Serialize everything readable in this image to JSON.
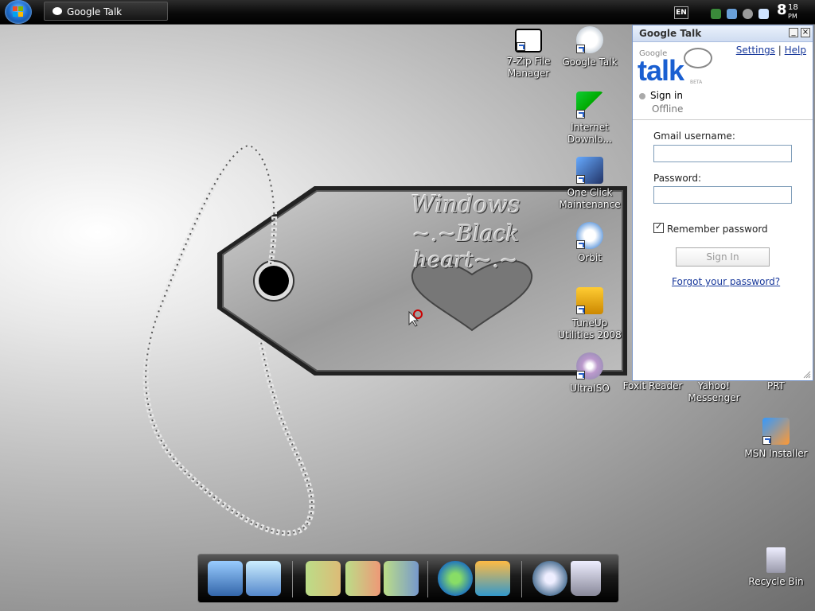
{
  "taskbar": {
    "active_window_label": "Google Talk",
    "language": "EN",
    "clock": {
      "hour": "8",
      "minutes": "18",
      "ampm": "PM"
    }
  },
  "wallpaper": {
    "line1": "Windows",
    "line2": "~.~Black heart~.~"
  },
  "desktop_icons": [
    {
      "label": "7-Zip File Manager",
      "icon": "7zip-icon"
    },
    {
      "label": "Google Talk",
      "icon": "google-talk-icon"
    },
    {
      "label": "Internet Downlo...",
      "icon": "internet-download-manager-icon"
    },
    {
      "label": "One Click Maintenance",
      "icon": "one-click-maintenance-icon"
    },
    {
      "label": "Orbit",
      "icon": "orbit-icon"
    },
    {
      "label": "TuneUp Utilities 2008",
      "icon": "tuneup-icon"
    },
    {
      "label": "UltraISO",
      "icon": "ultraiso-icon"
    },
    {
      "label": "Foxit Reader",
      "icon": "foxit-reader-icon"
    },
    {
      "label": "Yahoo! Messenger",
      "icon": "yahoo-messenger-icon"
    },
    {
      "label": "PRT",
      "icon": "prt-icon"
    },
    {
      "label": "MSN Installer",
      "icon": "msn-installer-icon"
    },
    {
      "label": "Recycle Bin",
      "icon": "recycle-bin-icon"
    }
  ],
  "gtalk": {
    "title": "Google Talk",
    "settings": "Settings",
    "help": "Help",
    "logo_google": "Google",
    "logo_talk": "talk",
    "logo_beta": "BETA",
    "sign_in": "Sign in",
    "status": "Offline",
    "username_label": "Gmail username:",
    "username_value": "",
    "password_label": "Password:",
    "password_value": "",
    "remember_label": "Remember password",
    "signin_button": "Sign In",
    "forgot_link": "Forgot your password?"
  },
  "dock": [
    "my-computer-icon",
    "control-panel-icon",
    "documents-folder-icon",
    "pictures-folder-icon",
    "network-folder-icon",
    "browser-globe-icon",
    "media-player-icon",
    "settings-gears-icon",
    "recycle-bin-icon"
  ]
}
